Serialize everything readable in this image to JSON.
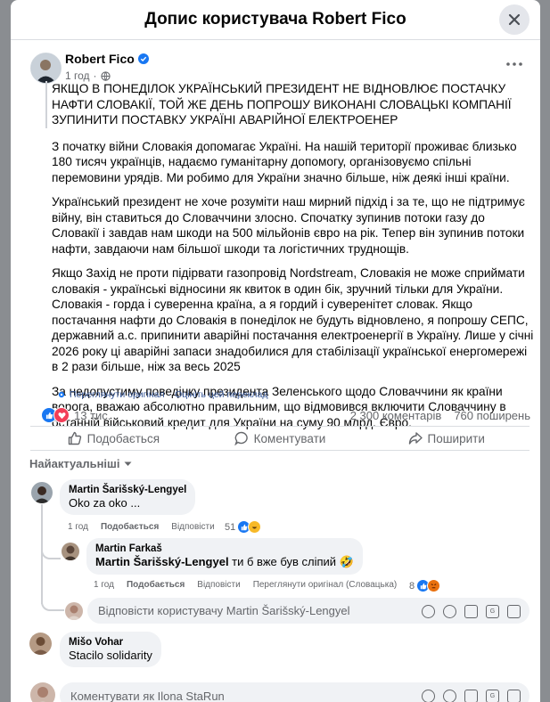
{
  "dialog": {
    "title": "Допис користувача Robert Fico"
  },
  "post": {
    "author": "Robert Fico",
    "time": "1 год",
    "headline": "ЯКЩО В ПОНЕДІЛОК УКРАЇНСЬКИЙ ПРЕЗИДЕНТ НЕ ВІДНОВЛЮЄ ПОСТАЧКУ НАФТИ СЛОВАКІЇ, ТОЙ ЖЕ ДЕНЬ ПОПРОШУ ВИКОНАНІ СЛОВАЦЬКІ КОМПАНІЇ ЗУПИНИТИ ПОСТАВКУ УКРАЇНІ АВАРІЙНОЇ ЕЛЕКТРОЕНЕР",
    "paragraphs": [
      "З початку війни Словакія допомагає Україні. На нашій території проживає близько 180 тисяч українців, надаємо гуманітарну допомогу, організовуємо спільні перемовини урядів. Ми робимо для України значно більше, ніж деякі інші країни.",
      "Український президент не хоче розуміти наш мирний підхід і за те, що не підтримує війну, він ставиться до Словаччини злосно. Спочатку зупинив потоки газу до Словакії і завдав нам шкоди на 500 мільйонів євро на рік. Тепер він зупинив потоки нафти, завдаючи нам більшої шкоди та логістичних труднощів.",
      "Якщо Захід не проти підірвати газопровід Nordstream, Словакія не може сприймати словакія - українські відносини як квиток в один бік, зручний тільки для України. Словакія - горда і суверенна країна, а я гордий і суверенітет словак. Якщо постачання нафти до Словакія в понеділок не будуть відновлено, я попрошу СЕПС, державний а.с. припинити аварійні постачання електроенергії в Україну. Лише у січні 2026 року ці аварійні запаси знадобилися для стабілізації української енергомережі в 2 рази більше, ніж за весь 2025",
      "За недопустиму поведінку президента Зеленського щодо Словаччини як країни ворога, вважаю абсолютно правильним, що відмовився включити Словаччину в останній військовий кредит для України на суму 90 млрд. Євро."
    ],
    "see_original": "Переглянути оригінал",
    "rate_translation": "Оцініть цей переклад",
    "separator": "·",
    "reactions_count": "13 тис.",
    "comments_count": "2 300 коментарів",
    "shares_count": "760 поширень"
  },
  "actions": {
    "like": "Подобається",
    "comment": "Коментувати",
    "share": "Поширити"
  },
  "sort_label": "Найактуальніші",
  "comments": [
    {
      "name": "Martin Šarišský-Lengyel",
      "text": "Oko za oko ...",
      "time": "1 год",
      "like": "Подобається",
      "reply": "Відповісти",
      "reactions": "51",
      "replies": [
        {
          "name": "Martin Farkaš",
          "mention": "Martin Šarišský-Lengyel",
          "text": " ти б вже був сліпий 🤣",
          "time": "1 год",
          "like": "Подобається",
          "reply": "Відповісти",
          "see_original": "Переглянути оригінал (Словацька)",
          "reactions": "8"
        }
      ],
      "reply_placeholder": "Відповісти користувачу Martin Šarišský-Lengyel"
    },
    {
      "name": "Mišo Vohar",
      "text": "Stacilo solidarity"
    }
  ],
  "composer_placeholder": "Коментувати як Ilona StaRun",
  "colors": {
    "link": "#385898",
    "like_blue": "#1877f2",
    "love_red": "#f33e58",
    "badge_blue": "#1877f2"
  },
  "icons": [
    "close-icon",
    "verified-badge-icon",
    "globe-icon",
    "more-icon",
    "gear-icon",
    "like-reaction-icon",
    "love-reaction-icon",
    "thumbs-up-icon",
    "comment-icon",
    "share-icon",
    "chevron-down-icon",
    "haha-reaction-icon",
    "angry-reaction-icon",
    "sticker-icon",
    "emoji-icon",
    "camera-icon",
    "gif-icon",
    "avatar-sticker-icon"
  ]
}
